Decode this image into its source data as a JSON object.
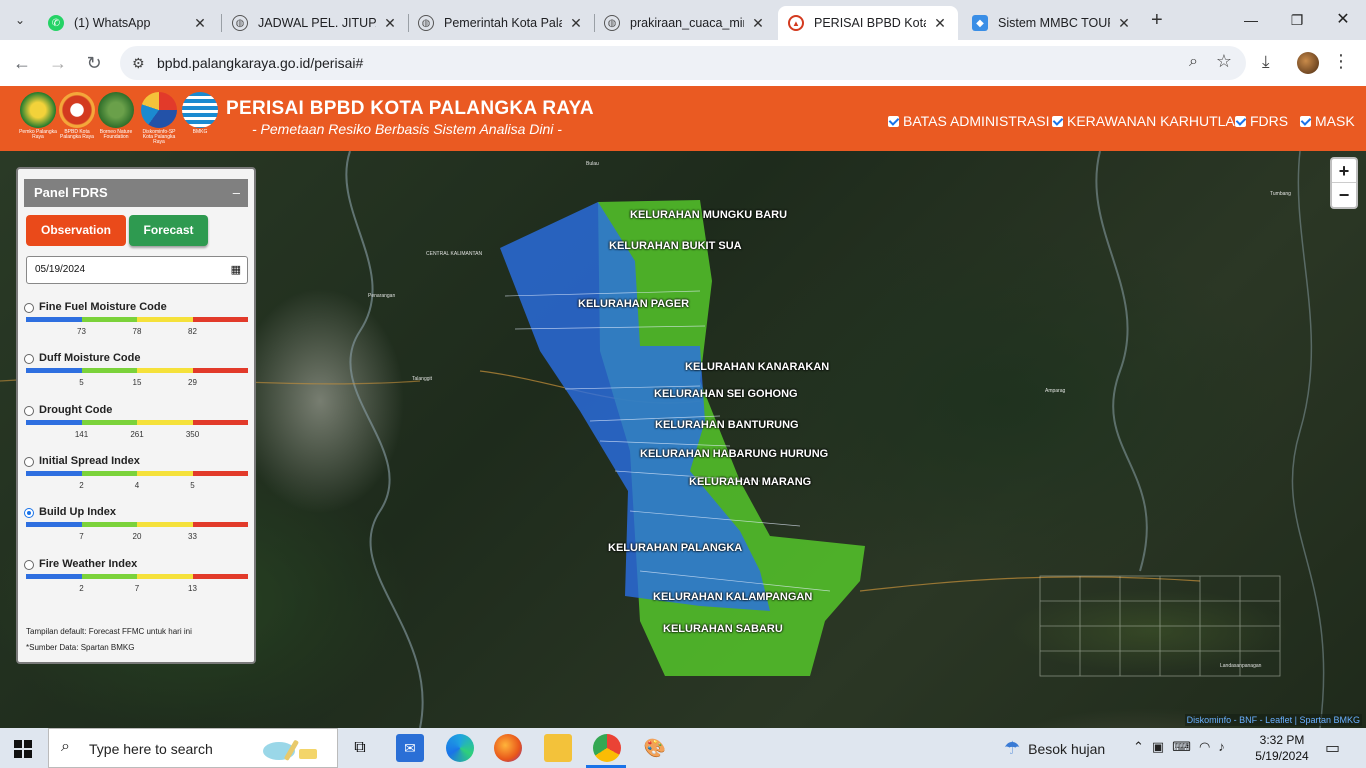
{
  "browser": {
    "tabs": [
      {
        "title": "(1) WhatsApp",
        "icon": "whatsapp-icon"
      },
      {
        "title": "JADWAL PEL. JITUPAS",
        "icon": "globe-icon"
      },
      {
        "title": "Pemerintah Kota Pala",
        "icon": "globe-icon"
      },
      {
        "title": "prakiraan_cuaca_ming",
        "icon": "globe-icon"
      },
      {
        "title": "PERISAI BPBD Kota P",
        "icon": "bpbd-icon",
        "active": true
      },
      {
        "title": "Sistem MMBC TOUR",
        "icon": "mmbc-icon"
      }
    ],
    "url": "bpbd.palangkaraya.go.id/perisai#"
  },
  "header": {
    "title": "PERISAI BPBD KOTA PALANGKA RAYA",
    "subtitle": "- Pemetaan Resiko Berbasis Sistem Analisa Dini -",
    "logos": [
      {
        "caption": "Pemko Palangka Raya",
        "color": "#1f7a2e"
      },
      {
        "caption": "BPBD Kota Palangka Raya",
        "color": "#d33a1f"
      },
      {
        "caption": "Borneo Nature Foundation",
        "color": "#2f6e2a"
      },
      {
        "caption": "Diskominfo-SP Kota Palangka Raya",
        "color": "#2352a8"
      },
      {
        "caption": "BMKG",
        "color": "#1b8ad0"
      }
    ],
    "layers": [
      {
        "label": "BATAS ADMINISTRASI",
        "checked": true
      },
      {
        "label": "KERAWANAN KARHUTLA",
        "checked": true
      },
      {
        "label": "FDRS",
        "checked": true
      },
      {
        "label": "MASK",
        "checked": true
      }
    ]
  },
  "panel": {
    "title": "Panel FDRS",
    "collapse": "–",
    "observation_label": "Observation",
    "forecast_label": "Forecast",
    "date_value": "05/19/2024",
    "indices": [
      {
        "name": "Fine Fuel Moisture Code",
        "ticks": [
          "73",
          "78",
          "82"
        ],
        "selected": false
      },
      {
        "name": "Duff Moisture Code",
        "ticks": [
          "5",
          "15",
          "29"
        ],
        "selected": false
      },
      {
        "name": "Drought Code",
        "ticks": [
          "141",
          "261",
          "350"
        ],
        "selected": false
      },
      {
        "name": "Initial Spread Index",
        "ticks": [
          "2",
          "4",
          "5"
        ],
        "selected": false
      },
      {
        "name": "Build Up Index",
        "ticks": [
          "7",
          "20",
          "33"
        ],
        "selected": true
      },
      {
        "name": "Fire Weather Index",
        "ticks": [
          "2",
          "7",
          "13"
        ],
        "selected": false
      }
    ],
    "scale_colors": [
      "#2e6fe0",
      "#7bd23a",
      "#f5e13a",
      "#e23a2a"
    ],
    "note_default": "Tampilan default: Forecast FFMC untuk hari ini",
    "note_source": "*Sumber Data: Spartan BMKG"
  },
  "map": {
    "zoom_in": "+",
    "zoom_out": "−",
    "attribution": "Diskominfo - BNF - Leaflet | Spartan BMKG",
    "kelurahan": [
      "KELURAHAN MUNGKU BARU",
      "KELURAHAN BUKIT SUA",
      "KELURAHAN PAGER",
      "KELURAHAN KANARAKAN",
      "KELURAHAN SEI GOHONG",
      "KELURAHAN BANTURUNG",
      "KELURAHAN HABARUNG HURUNG",
      "KELURAHAN MARANG",
      "KELURAHAN PALANGKA",
      "KELURAHAN KALAMPANGAN",
      "KELURAHAN SABARU"
    ]
  },
  "taskbar": {
    "search_placeholder": "Type here to search",
    "weather": "Besok hujan",
    "time": "3:32 PM",
    "date": "5/19/2024"
  }
}
